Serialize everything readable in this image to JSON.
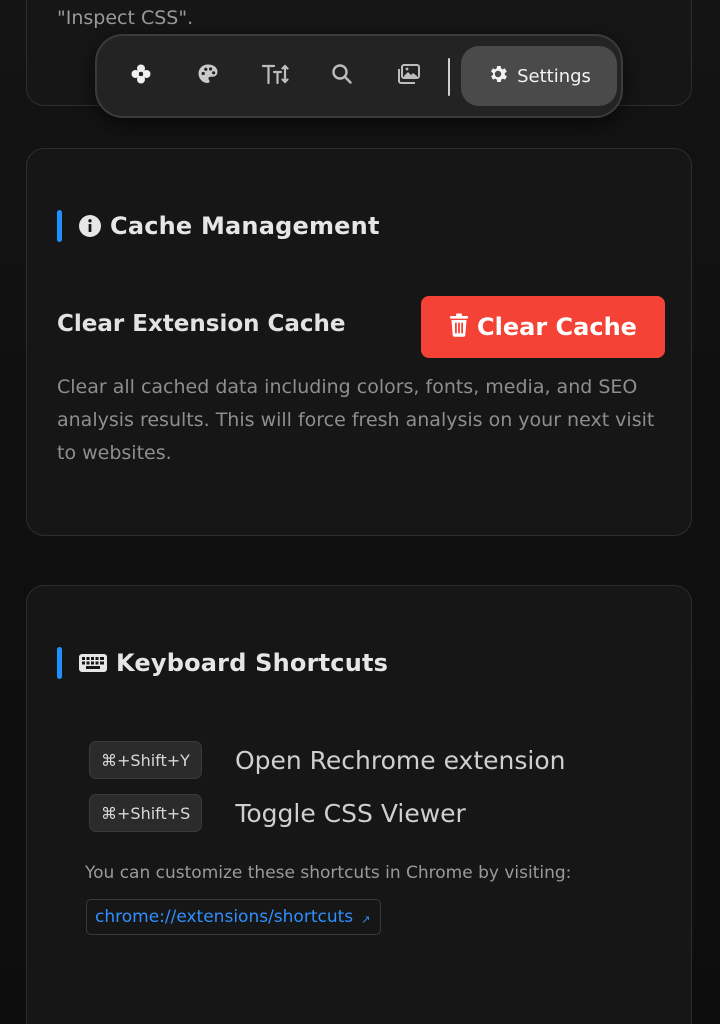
{
  "previous_card": {
    "text": "\"Inspect CSS\"."
  },
  "toolbar": {
    "buttons": [
      {
        "name": "flower-icon"
      },
      {
        "name": "palette-icon"
      },
      {
        "name": "text-size-icon"
      },
      {
        "name": "search-icon"
      },
      {
        "name": "media-icon"
      }
    ],
    "settings_label": "Settings",
    "settings_icon": "gear-icon"
  },
  "cache_section": {
    "title": "Cache Management",
    "icon": "info-icon",
    "row_label": "Clear Extension Cache",
    "button_label": "Clear Cache",
    "button_icon": "trash-icon",
    "description": "Clear all cached data including colors, fonts, media, and SEO analysis results. This will force fresh analysis on your next visit to websites."
  },
  "shortcuts_section": {
    "title": "Keyboard Shortcuts",
    "icon": "keyboard-icon",
    "items": [
      {
        "keys": "⌘+Shift+Y",
        "description": "Open Rechrome extension"
      },
      {
        "keys": "⌘+Shift+S",
        "description": "Toggle CSS Viewer"
      }
    ],
    "customize_text": "You can customize these shortcuts in Chrome by visiting:",
    "link_label": "chrome://extensions/shortcuts",
    "link_icon": "↗"
  },
  "colors": {
    "accent": "#1e90ff",
    "danger": "#f44336",
    "link": "#2f8fff",
    "background": "#0f0f0f",
    "card_border": "#2e2e2e"
  }
}
